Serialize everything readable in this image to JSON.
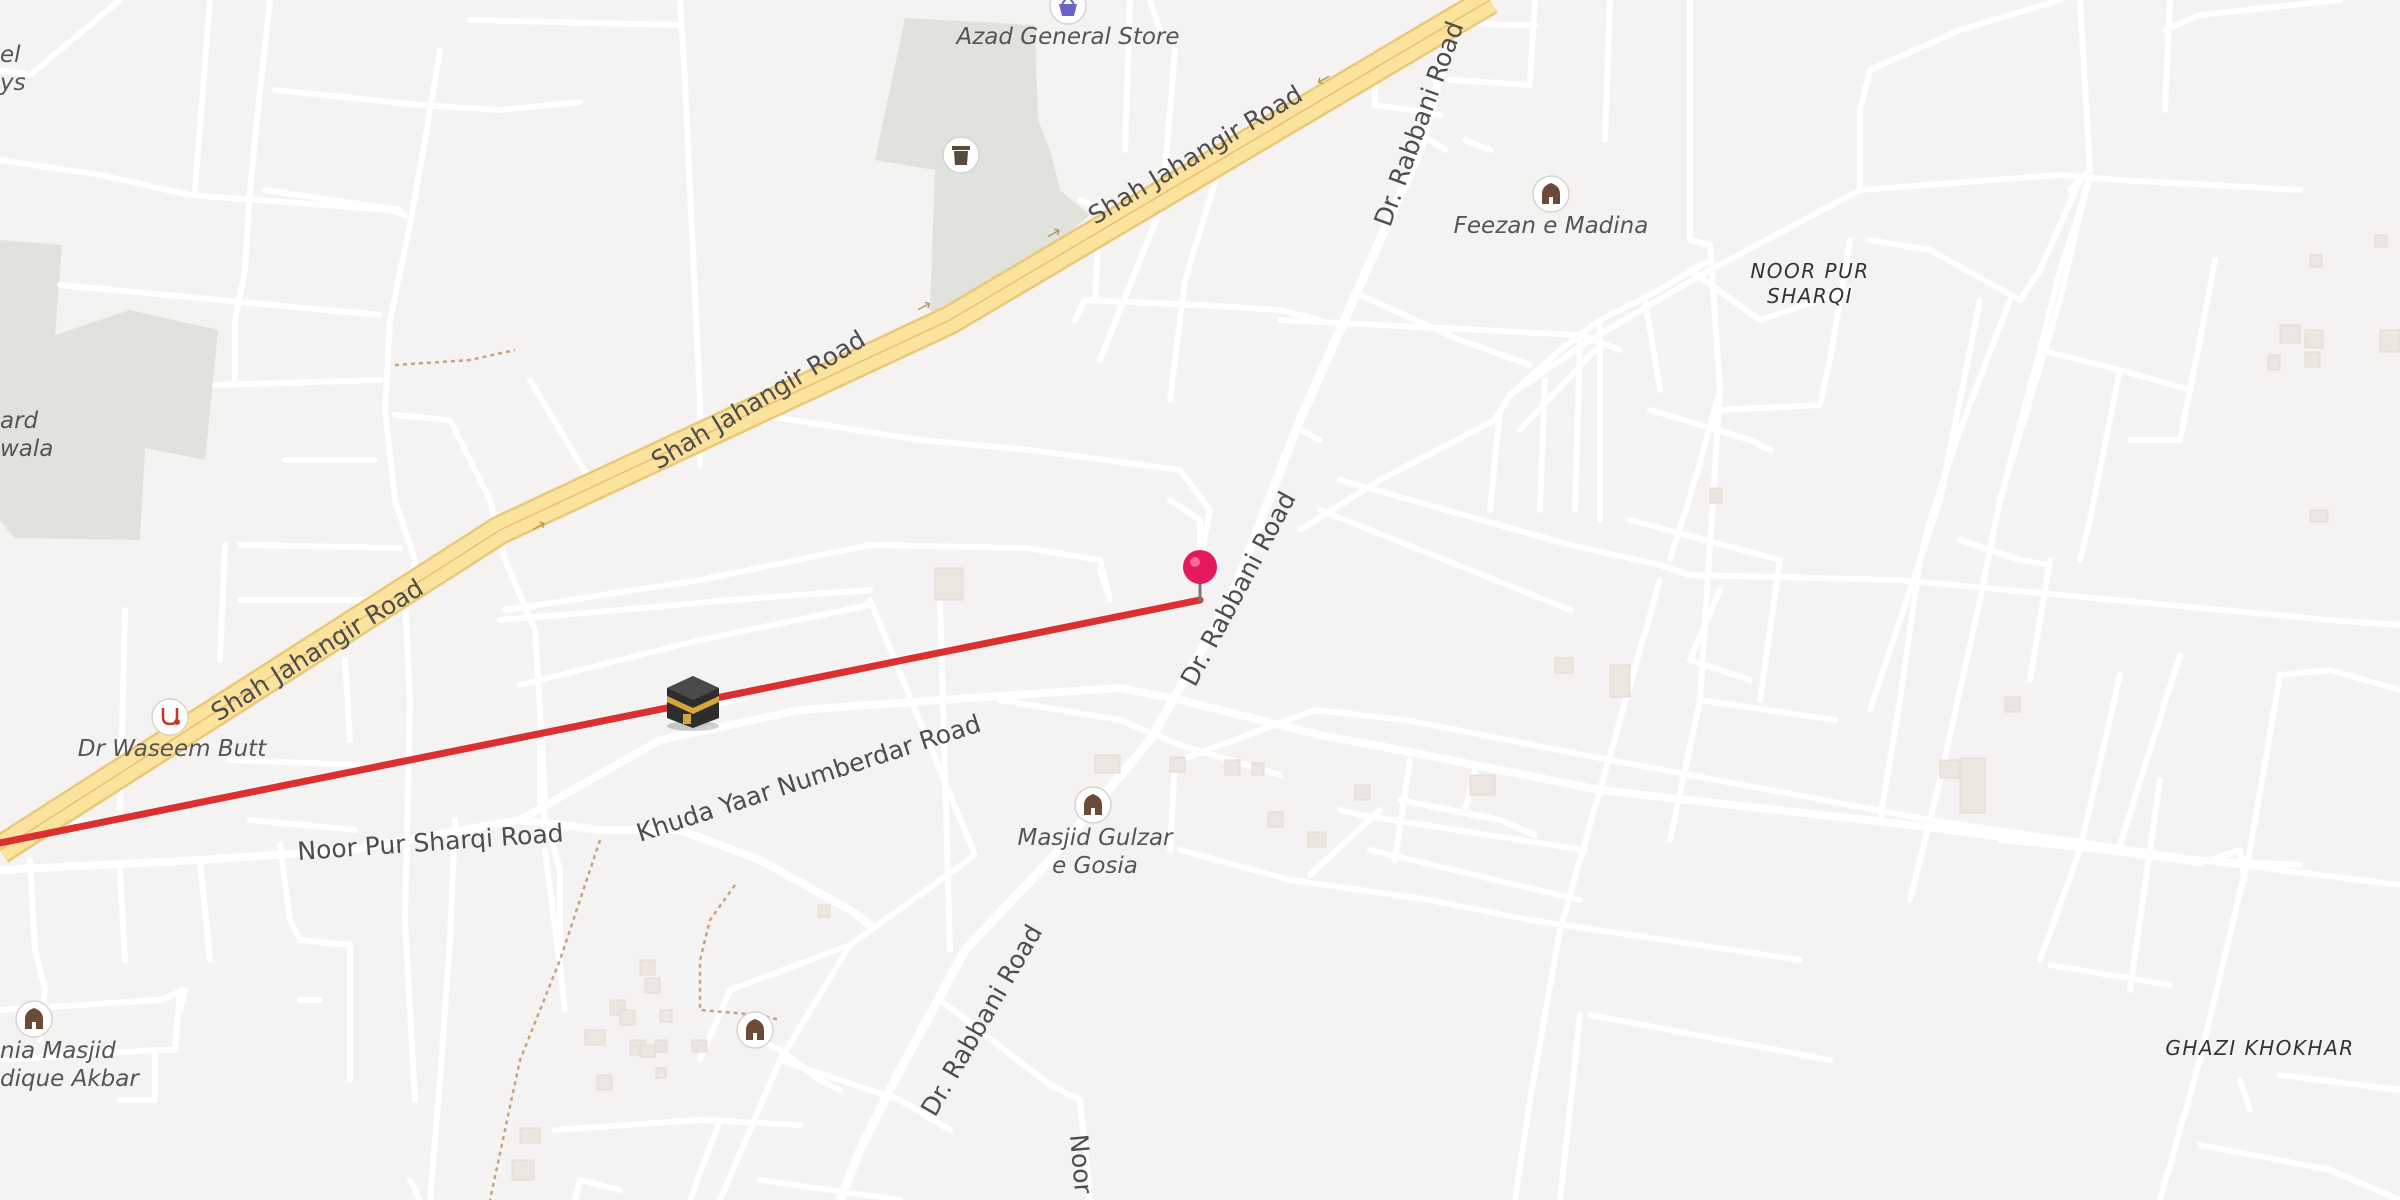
{
  "map": {
    "roads": {
      "highway_a": "Shah Jahangir Road",
      "highway_b": "Shah Jahangir Road",
      "highway_c": "Shah Jahangir Road",
      "rabbani_north": "Dr. Rabbani Road",
      "rabbani_mid": "Dr. Rabbani Road",
      "rabbani_south": "Dr. Rabbani Road",
      "khuda_yaar": "Khuda Yaar Numberdar Road",
      "noor_pur_sharqi_road": "Noor Pur Sharqi Road",
      "noor_fragment": "Noor"
    },
    "pois": {
      "azad_store": "Azad General Store",
      "feezan": "Feezan e Madina",
      "dr_waseem": "Dr Waseem Butt",
      "masjid_gulzar_1": "Masjid Gulzar",
      "masjid_gulzar_2": "e Gosia",
      "jamia_masjid_1": "nia Masjid",
      "jamia_masjid_2": "dique Akbar",
      "left_top_1": "el",
      "left_top_2": "ys",
      "left_mid_1": "ard",
      "left_mid_2": "wala"
    },
    "areas": {
      "noor_pur_1": "NOOR PUR",
      "noor_pur_2": "SHARQI",
      "ghazi": "GHAZI KHOKHAR"
    },
    "icons": {
      "pin": "map-pin-icon",
      "kaaba": "kaaba-icon",
      "mosque": "mosque-icon",
      "store": "shopping-basket-icon",
      "doctor": "stethoscope-icon",
      "cemetery": "cemetery-icon"
    },
    "colors": {
      "background": "#f5f3f1",
      "road": "#ffffff",
      "highway": "#fbe39e",
      "highway_edge": "#e9c877",
      "park": "#dfe3dc",
      "route_line": "#dc2f2f",
      "pin": "#e5195f",
      "text": "#555555"
    }
  }
}
